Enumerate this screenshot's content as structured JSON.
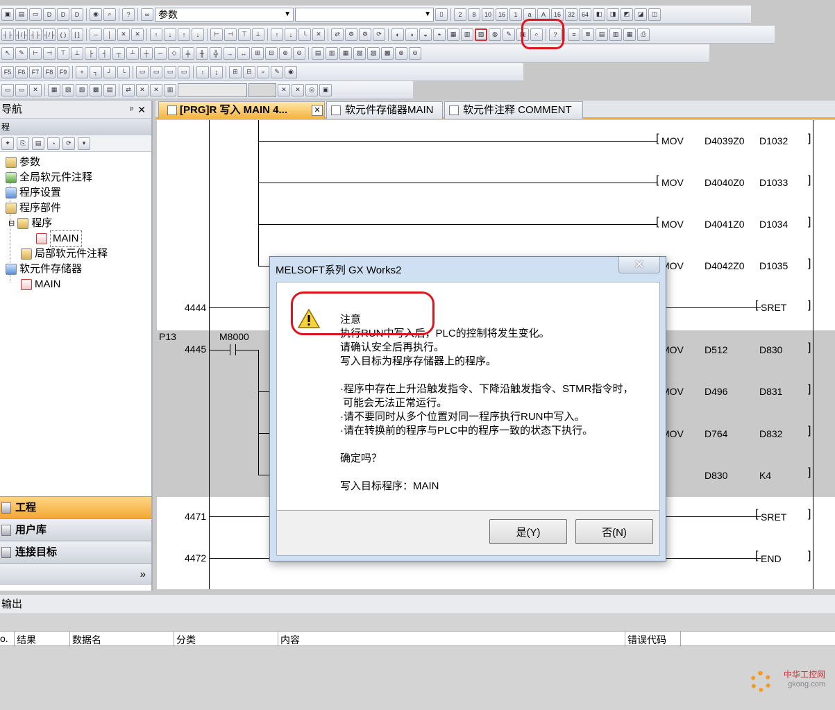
{
  "toolbar": {
    "combo_param": "参数",
    "combo_empty": ""
  },
  "nav": {
    "title": "导航",
    "pin": "ᵖ",
    "close": "✕",
    "subheader": "程",
    "tree": {
      "param": "参数",
      "global_comment": "全局软元件注释",
      "program_setting": "程序设置",
      "program_parts": "程序部件",
      "program": "程序",
      "main": "MAIN",
      "local_comment": "局部软元件注释",
      "device_memory": "软元件存储器",
      "device_main": "MAIN"
    },
    "bottom": {
      "project": "工程",
      "user_library": "用户库",
      "connection": "连接目标",
      "more": "»"
    }
  },
  "tabs": [
    {
      "label": "[PRG]R 写入 MAIN 4..."
    },
    {
      "label": "软元件存储器MAIN"
    },
    {
      "label": "软元件注释 COMMENT"
    }
  ],
  "ladder": {
    "rows": [
      {
        "step": "",
        "ins": "MOV",
        "a": "D4039Z0",
        "b": "D1032"
      },
      {
        "step": "",
        "ins": "MOV",
        "a": "D4040Z0",
        "b": "D1033"
      },
      {
        "step": "",
        "ins": "MOV",
        "a": "D4041Z0",
        "b": "D1034"
      },
      {
        "step": "",
        "ins": "MOV",
        "a": "D4042Z0",
        "b": "D1035"
      },
      {
        "step": "4444",
        "ins": "SRET",
        "a": "",
        "b": ""
      },
      {
        "step": "4445",
        "ins": "MOV",
        "a": "D512",
        "b": "D830"
      },
      {
        "step": "",
        "ins": "MOV",
        "a": "D496",
        "b": "D831"
      },
      {
        "step": "",
        "ins": "MOV",
        "a": "D764",
        "b": "D832"
      },
      {
        "step": "",
        "ins": "",
        "a": "D830",
        "b": "K4"
      },
      {
        "step": "4471",
        "ins": "SRET",
        "a": "",
        "b": ""
      },
      {
        "step": "4472",
        "ins": "END",
        "a": "",
        "b": ""
      }
    ],
    "pointer": "P13",
    "contact": "M8000"
  },
  "output": {
    "title": "输出",
    "columns": [
      "o.",
      "结果",
      "数据名",
      "分类",
      "内容",
      "错误代码"
    ]
  },
  "dialog": {
    "title": "MELSOFT系列 GX Works2",
    "close": "✕",
    "lines": [
      "注意",
      "执行RUN中写入后，PLC的控制将发生变化。",
      "请确认安全后再执行。",
      "写入目标为程序存储器上的程序。",
      "",
      "·程序中存在上升沿触发指令、下降沿触发指令、STMR指令时，",
      " 可能会无法正常运行。",
      "·请不要同时从多个位置对同一程序执行RUN中写入。",
      "·请在转换前的程序与PLC中的程序一致的状态下执行。",
      "",
      "确定吗？",
      "",
      "写入目标程序：MAIN"
    ],
    "yes_label": "是(Y)",
    "no_label": "否(N)"
  },
  "watermark": {
    "name": "中华工控网",
    "url": "gkong.com"
  }
}
